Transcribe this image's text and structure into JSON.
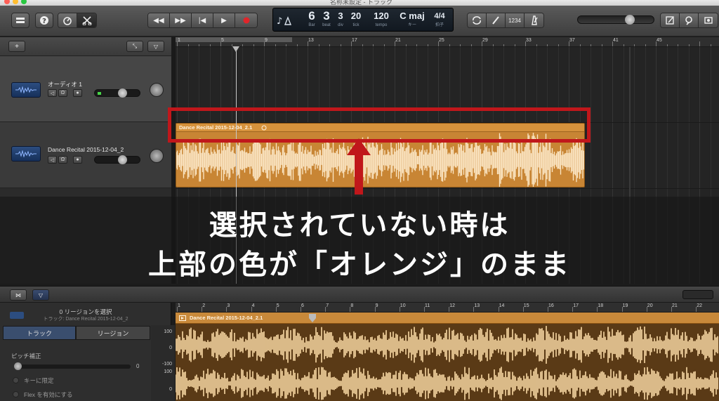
{
  "window": {
    "title": "名称未設定 - トラック"
  },
  "toolbar": {
    "buttons_left": [
      "library-icon",
      "help-icon",
      "smart-controls-icon",
      "editors-icon"
    ],
    "transport": [
      "rewind-icon",
      "fast-forward-icon",
      "go-to-start-icon",
      "play-icon",
      "record-icon"
    ],
    "lcd": {
      "bar": "6",
      "bar_label": "Bar",
      "beat": "3",
      "beat_label": "beat",
      "division": "3",
      "division_label": "div",
      "tick": "20",
      "tick_label": "tick",
      "tempo": "120",
      "tempo_label": "tempo",
      "key": "C maj",
      "key_label": "キー",
      "signature": "4/4",
      "signature_label": "拍子"
    },
    "count_in": "1234",
    "buttons_right": [
      "cycle-icon",
      "tuner-icon",
      "count-in-icon",
      "metronome-icon"
    ],
    "master_volume": 0.7
  },
  "tracks": [
    {
      "name": "オーディオ 1",
      "volume": 0.62
    },
    {
      "name": "Dance Recital 2015-12-04_2",
      "volume": 0.62
    }
  ],
  "ruler": {
    "bars": [
      "1",
      "5",
      "9",
      "13",
      "17",
      "21",
      "25",
      "29",
      "33",
      "37",
      "41",
      "45"
    ]
  },
  "region": {
    "label": "Dance Recital 2015-12-04_2.1"
  },
  "annotation": {
    "line1": "選択されていない時は",
    "line2": "上部の色が「オレンジ」のまま"
  },
  "editor": {
    "selection_count": "0 リージョンを選択",
    "track_info": "トラック: Dance Recital 2015-12-04_2",
    "tabs": [
      "トラック",
      "リージョン"
    ],
    "pitch_label": "ピッチ補正",
    "pitch_value": "0",
    "key_lock_label": "キーに限定",
    "flex_label": "Flex を有効にする",
    "y_labels": [
      "100",
      "0",
      "-100",
      "100",
      "0"
    ],
    "ruler_bars": [
      "1",
      "2",
      "3",
      "4",
      "5",
      "6",
      "7",
      "8",
      "9",
      "10",
      "11",
      "12",
      "13",
      "14",
      "15",
      "16",
      "17",
      "18",
      "19",
      "20",
      "21",
      "22"
    ],
    "region_label": "Dance Recital 2015-12-04_2.1"
  },
  "colors": {
    "region": "#c88534",
    "annotation": "#c0171b"
  }
}
